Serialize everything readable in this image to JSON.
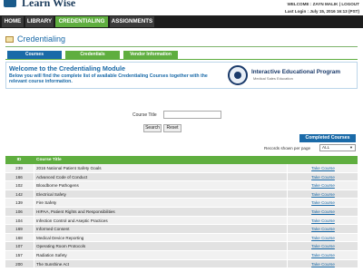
{
  "header": {
    "logo_text": "Learn Wise",
    "welcome": "WELCOME : ZAYN MALIK  |  LOGOUT",
    "last_login": "Last Login : July 15, 2016 16:13 (PST)"
  },
  "nav": {
    "home": "HOME",
    "library": "LIBRARY",
    "credentialing": "CREDENTIALING",
    "assignments": "ASSIGNMENTS"
  },
  "page": {
    "title": "Credentialing"
  },
  "subtabs": [
    "Courses",
    "Credentials",
    "Vendor Information"
  ],
  "intro": {
    "title": "Welcome to the Credentialing Module",
    "body": "Below you will find the complete list of available Credentialing Courses together with the relevant course information.",
    "brand_title": "Interactive Educational Program",
    "brand_sub": "Medical Sales Education"
  },
  "search": {
    "label": "Course Title",
    "value": "",
    "search_btn": "Search",
    "reset_btn": "Reset"
  },
  "completed_btn": "Completed Courses",
  "records": {
    "label": "Records shown per page",
    "selected": "ALL"
  },
  "table": {
    "headers": {
      "id": "ID",
      "title": "Course Title"
    },
    "rows": [
      {
        "id": "239",
        "title": "2016 National Patient Safety Goals",
        "action": "Take Course"
      },
      {
        "id": "166",
        "title": "Advanced Code of Conduct",
        "action": "Take Course"
      },
      {
        "id": "102",
        "title": "Bloodborne Pathogens",
        "action": "Take Course"
      },
      {
        "id": "142",
        "title": "Electrical Safety",
        "action": "Take Course"
      },
      {
        "id": "139",
        "title": "Fire Safety",
        "action": "Take Course"
      },
      {
        "id": "106",
        "title": "HIPAA, Patient Rights and Responsibilities",
        "action": "Take Course"
      },
      {
        "id": "104",
        "title": "Infection Control and Aseptic Practices",
        "action": "Take Course"
      },
      {
        "id": "169",
        "title": "Informed Consent",
        "action": "Take Course"
      },
      {
        "id": "168",
        "title": "Medical Device Reporting",
        "action": "Take Course"
      },
      {
        "id": "107",
        "title": "Operating Room Protocols",
        "action": "Take Course"
      },
      {
        "id": "157",
        "title": "Radiation Safety",
        "action": "Take Course"
      },
      {
        "id": "200",
        "title": "The Sunshine Act",
        "action": "Take Course"
      }
    ]
  },
  "colors": {
    "nav_active": "#5fae3f",
    "accent_blue": "#1a6aa8",
    "nav_bg": "#1c1c1c"
  }
}
